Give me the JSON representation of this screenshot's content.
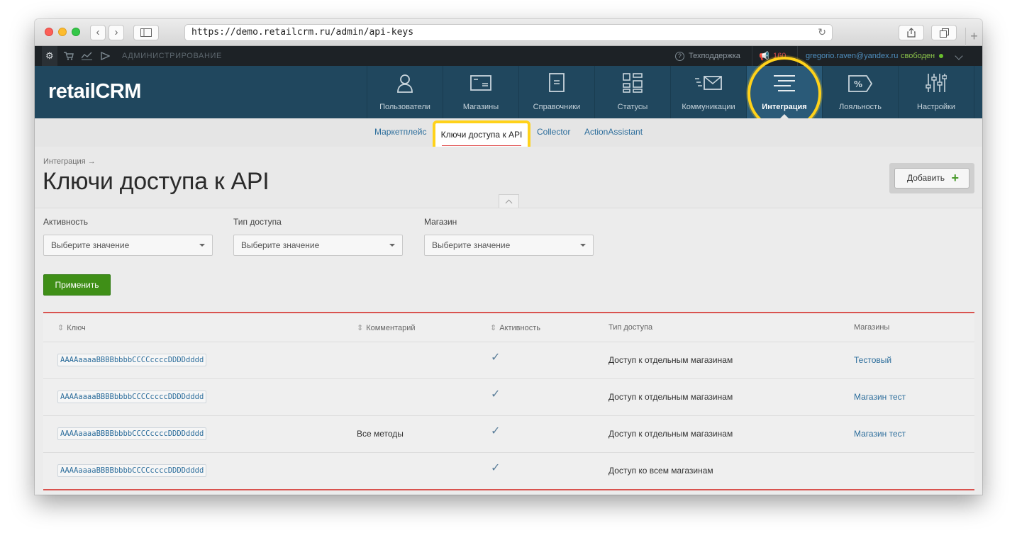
{
  "browser": {
    "url": "https://demo.retailcrm.ru/admin/api-keys",
    "back_glyph": "‹",
    "forward_glyph": "›",
    "reload_glyph": "↻",
    "newtab_glyph": "+"
  },
  "adminbar": {
    "section": "АДМИНИСТРИРОВАНИЕ",
    "support": "Техподдержка",
    "notifications": "160",
    "user_email": "gregorio.raven@yandex.ru",
    "status": "свободен"
  },
  "logo": {
    "text": "retailCRM"
  },
  "nav": {
    "items": [
      {
        "label": "Пользователи",
        "icon": "user-icon"
      },
      {
        "label": "Магазины",
        "icon": "window-icon"
      },
      {
        "label": "Справочники",
        "icon": "document-icon"
      },
      {
        "label": "Статусы",
        "icon": "grid-icon"
      },
      {
        "label": "Коммуникации",
        "icon": "envelope-icon"
      },
      {
        "label": "Интеграция",
        "icon": "lines-icon",
        "active": true
      },
      {
        "label": "Лояльность",
        "icon": "percent-tag-icon"
      },
      {
        "label": "Настройки",
        "icon": "sliders-icon"
      }
    ]
  },
  "subnav": {
    "items": [
      "Маркетплейс",
      "Ключи доступа к API",
      "Collector",
      "ActionAssistant"
    ]
  },
  "page": {
    "breadcrumb": "Интеграция →",
    "title": "Ключи доступа к API",
    "add_button": "Добавить",
    "add_plus": "+"
  },
  "filters": {
    "activity_label": "Активность",
    "access_type_label": "Тип доступа",
    "shop_label": "Магазин",
    "placeholder": "Выберите значение",
    "apply_button": "Применить"
  },
  "table": {
    "columns": {
      "key": "Ключ",
      "comment": "Комментарий",
      "active": "Активность",
      "access_type": "Тип доступа",
      "shops": "Магазины"
    },
    "check_glyph": "✓",
    "rows": [
      {
        "key": "AAAAaaaaBBBBbbbbCCCCccccDDDDdddd",
        "comment": "",
        "access_type": "Доступ к отдельным магазинам",
        "shops": "Тестовый"
      },
      {
        "key": "AAAAaaaaBBBBbbbbCCCCccccDDDDdddd",
        "comment": "",
        "access_type": "Доступ к отдельным магазинам",
        "shops": "Магазин тест"
      },
      {
        "key": "AAAAaaaaBBBBbbbbCCCCccccDDDDdddd",
        "comment": "Все методы",
        "access_type": "Доступ к отдельным магазинам",
        "shops": "Магазин тест"
      },
      {
        "key": "AAAAaaaaBBBBbbbbCCCCccccDDDDdddd",
        "comment": "",
        "access_type": "Доступ ко всем магазинам",
        "shops": ""
      }
    ]
  },
  "colors": {
    "highlight": "#ffd21a",
    "nav_bg": "#20475e",
    "apply_green": "#3f8f17",
    "table_border": "#d9534f"
  }
}
